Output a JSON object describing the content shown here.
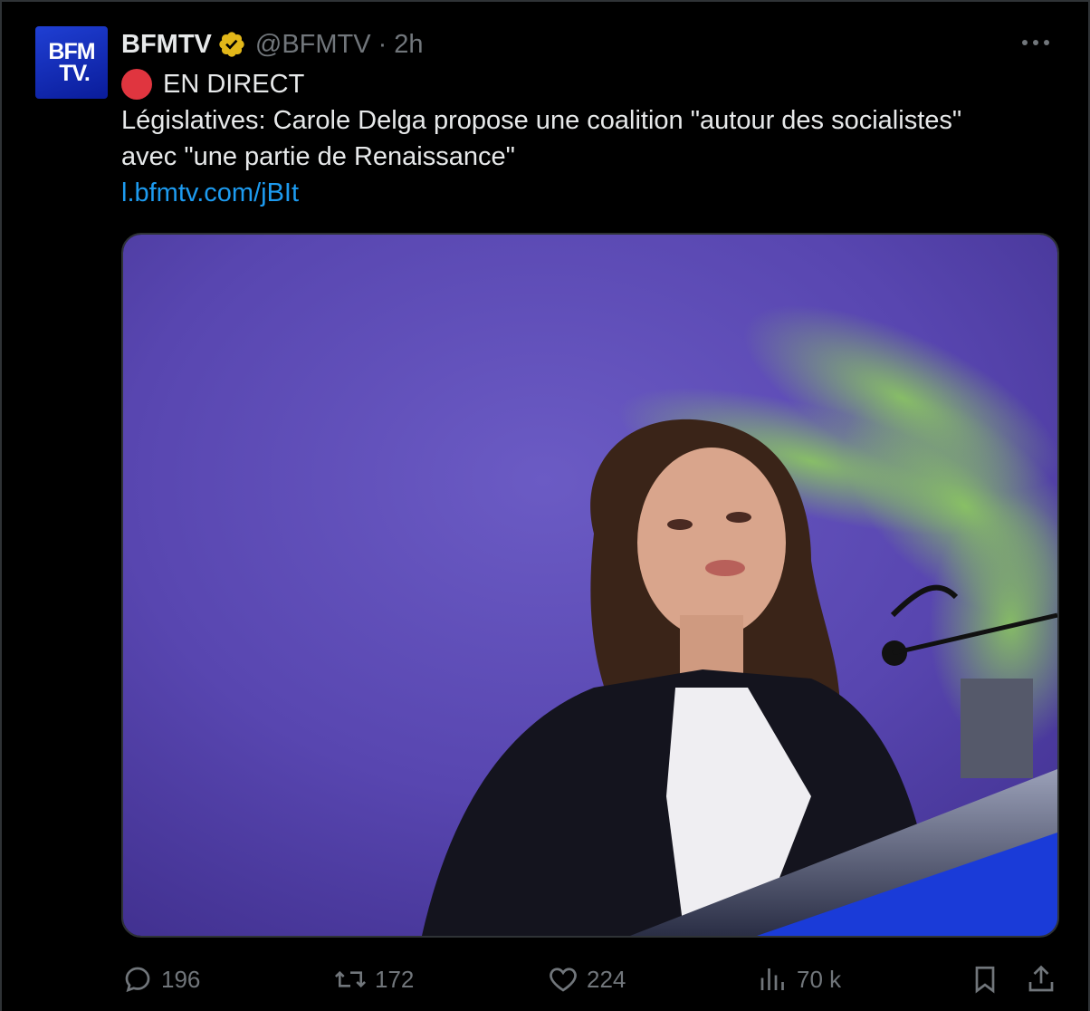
{
  "tweet": {
    "author": {
      "display_name": "BFMTV",
      "handle": "@BFMTV",
      "time": "2h",
      "separator": "·",
      "avatar_text_line1": "BFM",
      "avatar_text_line2": "TV.",
      "verified_icon": "verified-badge-icon"
    },
    "live_label": "EN DIRECT",
    "body_line1": "Législatives: Carole Delga propose une coalition \"autour des socialistes\"",
    "body_line2": "avec \"une partie de Renaissance\"",
    "link": "l.bfmtv.com/jBIt",
    "media": {
      "icon": "photo-image"
    },
    "actions": {
      "replies": "196",
      "retweets": "172",
      "likes": "224",
      "views": "70 k"
    }
  },
  "colors": {
    "background": "#000000",
    "text": "#e7e9ea",
    "muted": "#71767b",
    "link": "#1d9bf0",
    "live": "#e0353f",
    "verified": "#e2b719",
    "avatar": "#1a33c4"
  }
}
